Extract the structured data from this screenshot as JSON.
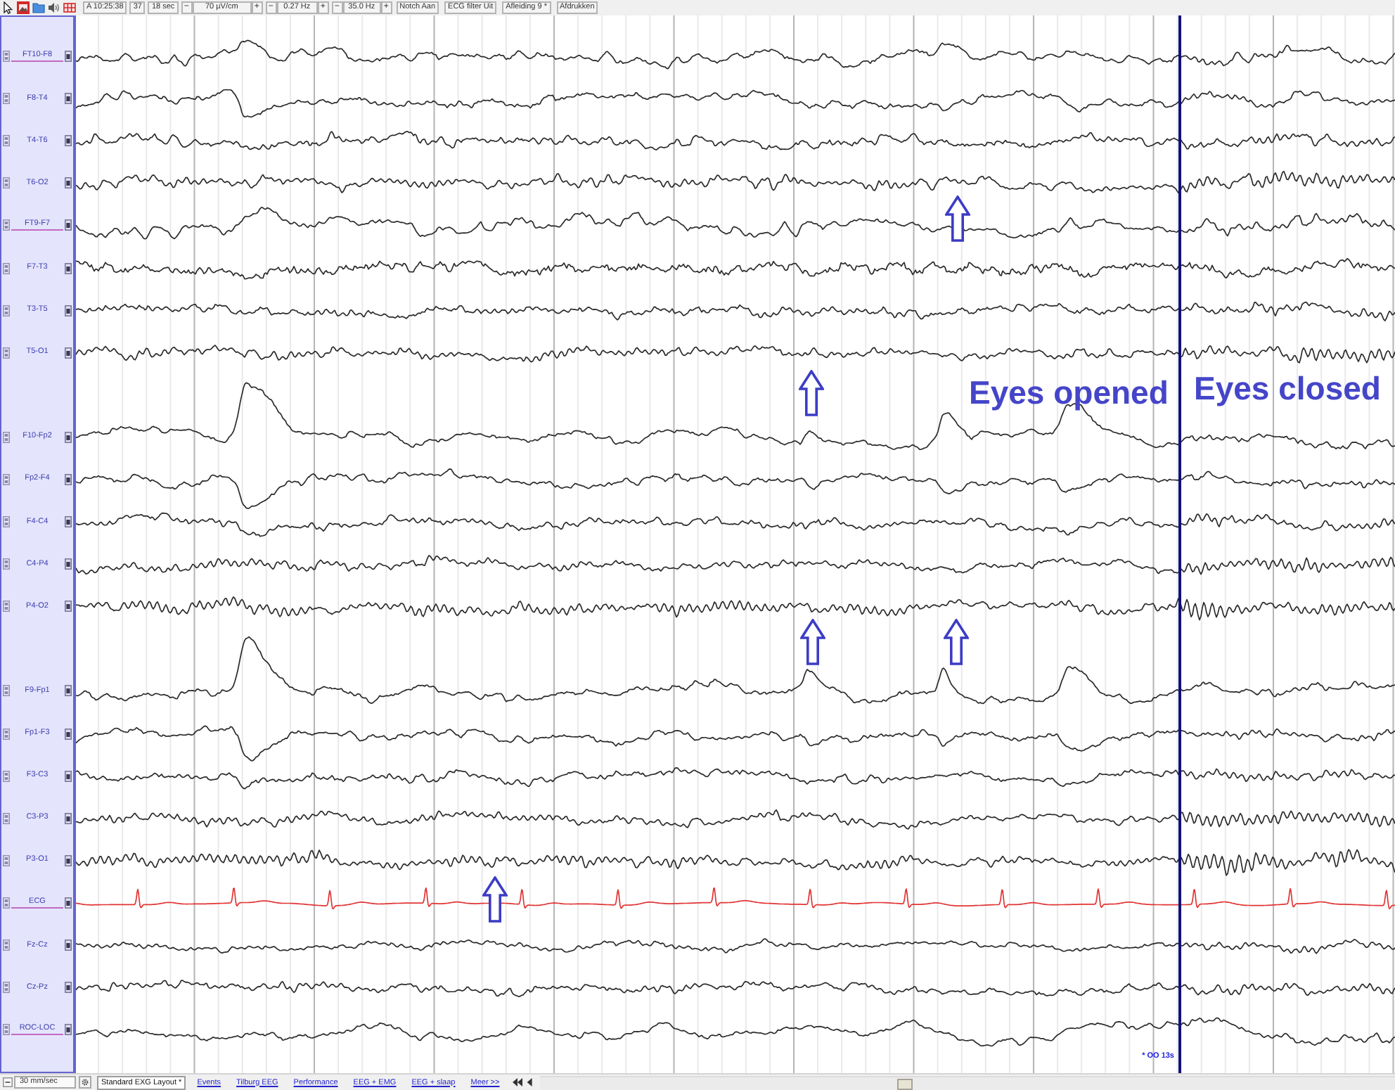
{
  "toolbar": {
    "items": [
      {
        "kind": "field",
        "text": "A 10:25:38"
      },
      {
        "kind": "field",
        "text": "37"
      },
      {
        "kind": "field",
        "text": "18 sec"
      },
      {
        "kind": "stepper",
        "minus": "−",
        "value": "70 µV/cm",
        "plus": "+"
      },
      {
        "kind": "stepper",
        "minus": "−",
        "value": "0.27 Hz",
        "plus": "+"
      },
      {
        "kind": "stepper",
        "minus": "−",
        "value": "35.0 Hz",
        "plus": "+"
      },
      {
        "kind": "button",
        "label": "Notch Aan"
      },
      {
        "kind": "button",
        "label": "ECG filter Uit"
      },
      {
        "kind": "button",
        "label": "Afleiding 9 *"
      },
      {
        "kind": "button",
        "label": "Afdrukken"
      }
    ]
  },
  "montage": {
    "groups": [
      {
        "channels": [
          {
            "label": "FT10-F8",
            "kind": "eeg",
            "marked": true
          },
          {
            "label": "F8-T4",
            "kind": "eeg",
            "marked": false
          },
          {
            "label": "T4-T6",
            "kind": "eeg",
            "marked": false
          },
          {
            "label": "T6-O2",
            "kind": "eeg",
            "marked": false
          },
          {
            "label": "FT9-F7",
            "kind": "eeg",
            "marked": true
          },
          {
            "label": "F7-T3",
            "kind": "eeg",
            "marked": false
          },
          {
            "label": "T3-T5",
            "kind": "eeg",
            "marked": false
          },
          {
            "label": "T5-O1",
            "kind": "eeg",
            "marked": false
          }
        ]
      },
      {
        "channels": [
          {
            "label": "F10-Fp2",
            "kind": "eeg",
            "marked": false
          },
          {
            "label": "Fp2-F4",
            "kind": "eeg",
            "marked": false
          },
          {
            "label": "F4-C4",
            "kind": "eeg",
            "marked": false
          },
          {
            "label": "C4-P4",
            "kind": "eeg",
            "marked": false
          },
          {
            "label": "P4-O2",
            "kind": "eeg",
            "marked": false
          }
        ]
      },
      {
        "channels": [
          {
            "label": "F9-Fp1",
            "kind": "eeg",
            "marked": false
          },
          {
            "label": "Fp1-F3",
            "kind": "eeg",
            "marked": false
          },
          {
            "label": "F3-C3",
            "kind": "eeg",
            "marked": false
          },
          {
            "label": "C3-P3",
            "kind": "eeg",
            "marked": false
          },
          {
            "label": "P3-O1",
            "kind": "eeg",
            "marked": false
          },
          {
            "label": "ECG",
            "kind": "ecg",
            "marked": true
          },
          {
            "label": "Fz-Cz",
            "kind": "eeg",
            "marked": false
          },
          {
            "label": "Cz-Pz",
            "kind": "eeg",
            "marked": false
          },
          {
            "label": "ROC-LOC",
            "kind": "eeg",
            "marked": true
          }
        ]
      }
    ]
  },
  "annotations": [
    {
      "kind": "text",
      "text": "Eyes opened"
    },
    {
      "kind": "text",
      "text": "Eyes closed"
    }
  ],
  "event_marker": {
    "label": "* OO 13s"
  },
  "bottom_bar": {
    "speed": "30 mm/sec",
    "tabs": [
      {
        "label": "Standard EXG Layout *",
        "selected": true
      },
      {
        "label": "Events",
        "selected": false
      },
      {
        "label": "Tilburg EEG",
        "selected": false
      },
      {
        "label": "Performance",
        "selected": false
      },
      {
        "label": "EEG + EMG",
        "selected": false
      },
      {
        "label": "EEG + slaap",
        "selected": false
      },
      {
        "label": "Meer >>",
        "selected": false
      }
    ]
  }
}
